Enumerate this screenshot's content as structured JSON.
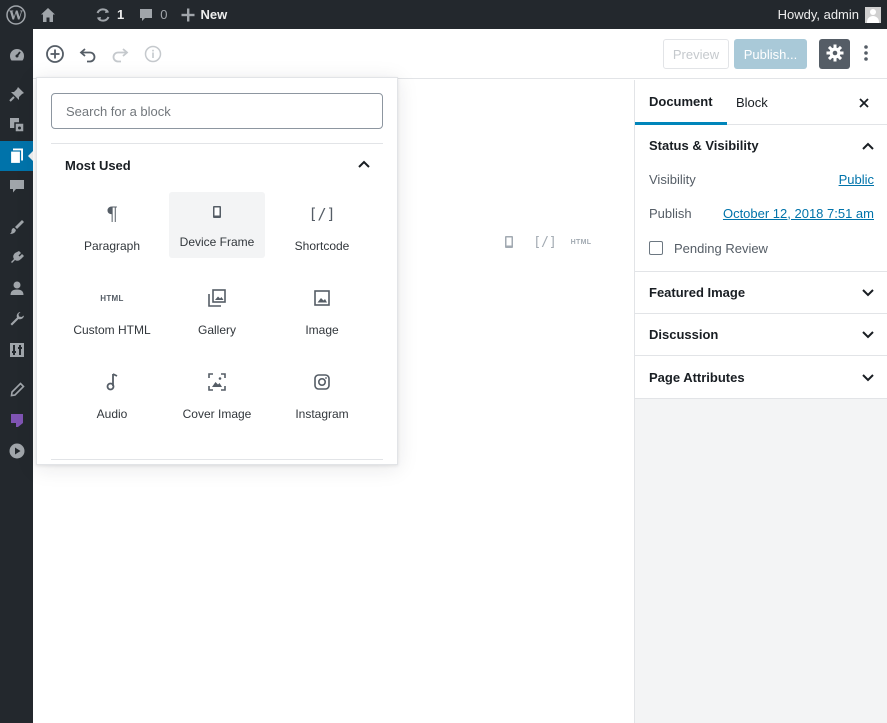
{
  "admin_bar": {
    "updates_count": "1",
    "comments_count": "0",
    "new_label": "New",
    "howdy": "Howdy, admin",
    "icons": [
      "wordpress-logo-icon",
      "home-icon",
      "updates-icon",
      "comments-icon",
      "plus-icon",
      "avatar"
    ]
  },
  "admin_menu": {
    "icons": [
      "dashboard-icon",
      "pin-icon",
      "media-icon",
      "pages-icon",
      "comments-icon",
      "appearance-icon",
      "plugins-icon",
      "users-icon",
      "tools-icon",
      "settings-icon",
      "edit-icon",
      "forms-icon",
      "play-icon"
    ],
    "current": "pages-icon"
  },
  "header": {
    "preview_label": "Preview",
    "publish_label": "Publish...",
    "icons": [
      "add-block-icon",
      "undo-icon",
      "redo-icon",
      "info-icon",
      "gear-icon",
      "more-vertical-icon"
    ]
  },
  "inserter": {
    "search_placeholder": "Search for a block",
    "panel_title": "Most Used",
    "blocks": [
      {
        "label": "Paragraph",
        "icon": "paragraph-icon"
      },
      {
        "label": "Device Frame",
        "icon": "device-icon"
      },
      {
        "label": "Shortcode",
        "icon": "shortcode-icon"
      },
      {
        "label": "Custom HTML",
        "icon": "html-icon"
      },
      {
        "label": "Gallery",
        "icon": "gallery-icon"
      },
      {
        "label": "Image",
        "icon": "image-icon"
      },
      {
        "label": "Audio",
        "icon": "audio-icon"
      },
      {
        "label": "Cover Image",
        "icon": "cover-image-icon"
      },
      {
        "label": "Instagram",
        "icon": "instagram-icon"
      }
    ],
    "icon_text": {
      "paragraph": "¶",
      "shortcode": "[/]",
      "html": "HTML"
    }
  },
  "canvas": {
    "quick_icons": {
      "shortcode": "[/]",
      "html": "HTML"
    }
  },
  "sidebar": {
    "tab_document": "Document",
    "tab_block": "Block",
    "status_visibility": "Status & Visibility",
    "visibility_label": "Visibility",
    "visibility_value": "Public",
    "publish_label": "Publish",
    "publish_value": "October 12, 2018 7:51 am",
    "pending_review": "Pending Review",
    "featured_image": "Featured Image",
    "discussion": "Discussion",
    "page_attributes": "Page Attributes"
  },
  "colors": {
    "admin_dark": "#23282d",
    "accent": "#0073aa",
    "tab_active": "#0085ba",
    "publish_disabled": "#a9c9d8",
    "sidebar_bg": "#f3f4f5"
  }
}
